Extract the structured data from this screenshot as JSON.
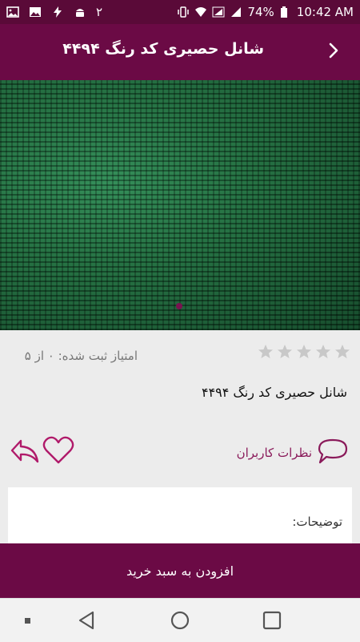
{
  "status_bar": {
    "left_icons": [
      "image-icon",
      "photo-icon",
      "flash-icon",
      "android-icon"
    ],
    "notification_count": "۲",
    "battery_percent": "74%",
    "time": "10:42 AM"
  },
  "app_bar": {
    "title": "شانل حصیری کد رنگ ۴۴۹۴"
  },
  "rating": {
    "stars_total": 5,
    "stars_filled": 0,
    "text": "امتیاز ثبت شده: ۰ از ۵"
  },
  "product": {
    "name": "شانل حصیری کد رنگ ۴۴۹۴"
  },
  "actions": {
    "comments_label": "نظرات کاربران"
  },
  "description": {
    "label": "توضیحات:"
  },
  "cart": {
    "label": "افزودن به سبد خرید"
  },
  "colors": {
    "primary": "#6b0a45",
    "status_bar": "#5a0a38",
    "accent": "#8a1a5a"
  }
}
